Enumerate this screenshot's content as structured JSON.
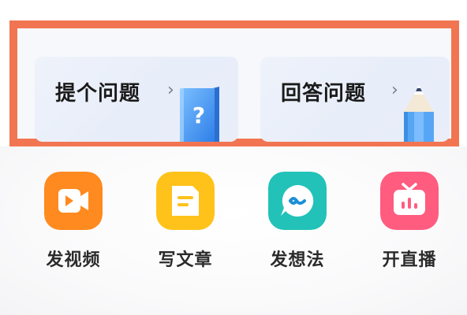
{
  "cards": [
    {
      "title": "提个问题",
      "chevron": "›",
      "illustration": "question-book-icon"
    },
    {
      "title": "回答问题",
      "chevron": "›",
      "illustration": "pencil-icon"
    }
  ],
  "actions": [
    {
      "label": "发视频",
      "icon": "video-camera-icon",
      "color": "#ff8a1f"
    },
    {
      "label": "写文章",
      "icon": "article-icon",
      "color": "#ffc21a"
    },
    {
      "label": "发想法",
      "icon": "idea-chat-icon",
      "color": "#22c2b8"
    },
    {
      "label": "开直播",
      "icon": "live-tv-icon",
      "color": "#ff5c80"
    }
  ],
  "colors": {
    "highlight_border": "#f27552",
    "card_bg": "#e9eef9",
    "book_blue": "#3b8ff0",
    "pencil_blue": "#56a6f5"
  }
}
